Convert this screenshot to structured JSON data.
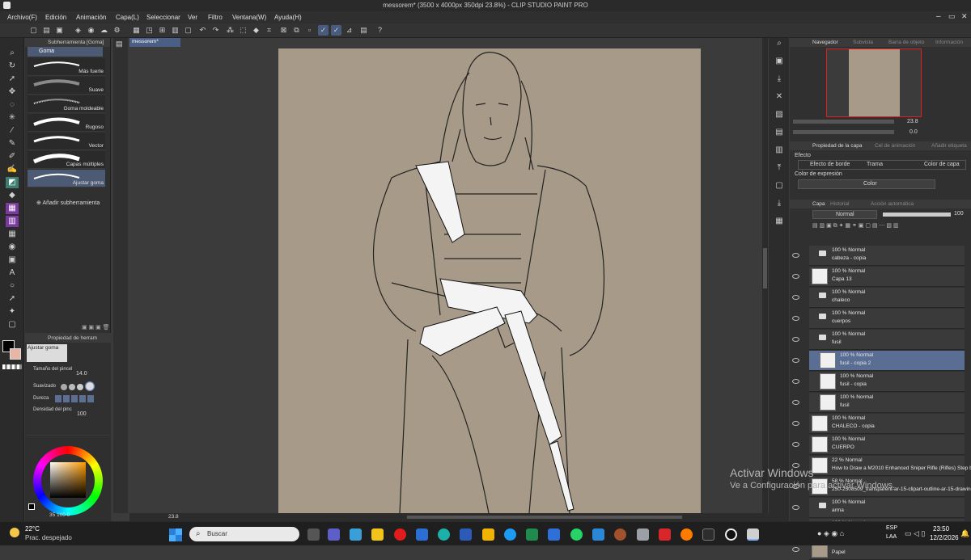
{
  "titlebar": {
    "title": "messorem* (3500 x 4000px 350dpi 23.8%) - CLIP STUDIO PAINT PRO"
  },
  "menu": [
    "Archivo(F)",
    "Edición",
    "Animación",
    "Capa(L)",
    "Seleccionar",
    "Ver",
    "Filtro",
    "Ventana(W)",
    "Ayuda(H)"
  ],
  "subtool": {
    "header": "Subherramienta [Goma]",
    "group": "Goma",
    "brushes": [
      "Más fuerte",
      "Suave",
      "Goma moldeable",
      "Rugoso",
      "Vector",
      "Capas múltiples",
      "Ajustar goma"
    ],
    "add": "Añadir subherramienta"
  },
  "toolprop": {
    "header": "Propiedad de herram",
    "title": "Ajustar goma",
    "size_label": "Tamaño del pincel",
    "size_value": "14.0",
    "smooth_label": "Suavizado",
    "hard_label": "Dureza",
    "density_label": "Densidad del pinc",
    "density_value": "100"
  },
  "color": {
    "values": "35 100 0"
  },
  "doc": {
    "tab": "messorem*",
    "zoom": "23.8"
  },
  "navigator": {
    "tabs": [
      "Navegador",
      "Subvista",
      "Barra de objeto",
      "Información"
    ],
    "zoom": "23.8",
    "angle": "0.0"
  },
  "layerprop": {
    "tabs": [
      "Propiedad de la capa",
      "Cel de animación",
      "Añadir etiqueta"
    ],
    "effect_label": "Efecto",
    "effects": [
      "Efecto de borde",
      "Trama",
      "Color de capa"
    ],
    "expr_label": "Color de expresión",
    "expr_value": "Color"
  },
  "layers": {
    "tabs": [
      "Capa",
      "Historial",
      "Acción automática"
    ],
    "blend": "Normal",
    "opacity": "100",
    "rows": [
      {
        "l1": "100 % Normal",
        "l2": "cabeza - copia",
        "type": "folder",
        "indent": 0
      },
      {
        "l1": "100 % Normal",
        "l2": "Capa 13",
        "type": "layer",
        "indent": 0
      },
      {
        "l1": "100 % Normal",
        "l2": "chaleco",
        "type": "folder",
        "indent": 0
      },
      {
        "l1": "100 % Normal",
        "l2": "cuerpos",
        "type": "folder",
        "indent": 0
      },
      {
        "l1": "100 % Normal",
        "l2": "fusil",
        "type": "folder",
        "indent": 0
      },
      {
        "l1": "100 % Normal",
        "l2": "fusil - copia 2",
        "type": "layer",
        "indent": 1,
        "selected": true
      },
      {
        "l1": "100 % Normal",
        "l2": "fusil - copia",
        "type": "layer",
        "indent": 1
      },
      {
        "l1": "100 % Normal",
        "l2": "fusil",
        "type": "layer",
        "indent": 1
      },
      {
        "l1": "100 % Normal",
        "l2": "CHALECO - copia",
        "type": "layer",
        "indent": 0
      },
      {
        "l1": "100 % Normal",
        "l2": "CUERPO",
        "type": "layer",
        "indent": 0
      },
      {
        "l1": "22 % Normal",
        "l2": "How to Draw a M2010 Enhanced Sniper Rifle (Rifles) Step by Step",
        "type": "layer",
        "indent": 0
      },
      {
        "l1": "58 % Normal",
        "l2": "250-2508509_transparent-ar-15-clipart-outline-ar-15-drawing-hd",
        "type": "layer",
        "indent": 0
      },
      {
        "l1": "100 % Normal",
        "l2": "arma",
        "type": "folder",
        "indent": 0
      },
      {
        "l1": "100 % Normal",
        "l2": "Carpeta 1",
        "type": "folder",
        "indent": 0
      },
      {
        "l1": "",
        "l2": "Papel",
        "type": "paper",
        "indent": 0
      }
    ]
  },
  "watermark": {
    "line1": "Activar Windows",
    "line2": "Ve a Configuración para activar Windows."
  },
  "taskbar": {
    "temp": "22°C",
    "weather": "Prac. despejado",
    "search": "Buscar",
    "lang1": "ESP",
    "lang2": "LAA",
    "time": "23:50",
    "date": "12/2/2026"
  }
}
